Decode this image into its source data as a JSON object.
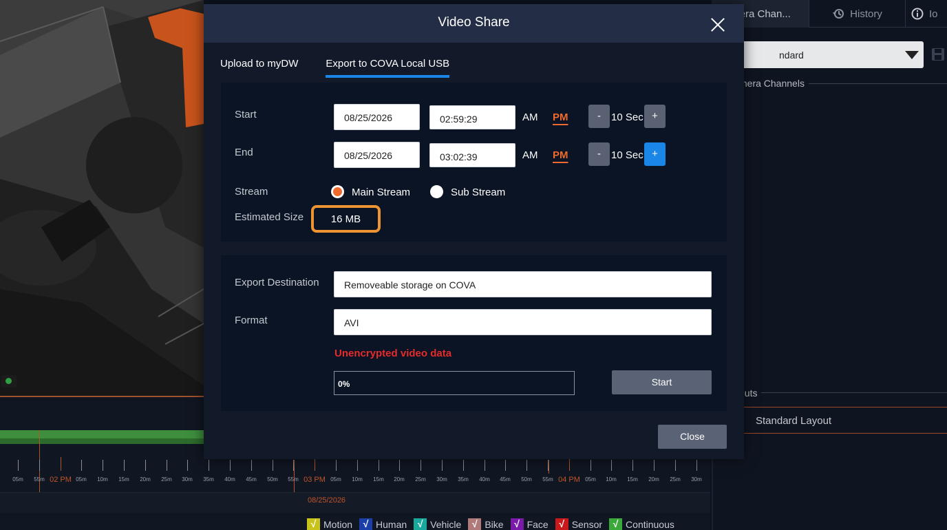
{
  "modal": {
    "title": "Video Share",
    "tabs": [
      {
        "label": "Upload to myDW",
        "active": false
      },
      {
        "label": "Export to COVA Local USB",
        "active": true
      }
    ],
    "start": {
      "label": "Start",
      "date": "08/25/2026",
      "time": "02:59:29",
      "am": "AM",
      "pm": "PM",
      "selected_period": "PM",
      "minus": "-",
      "step": "10 Sec",
      "plus": "+"
    },
    "end": {
      "label": "End",
      "date": "08/25/2026",
      "time": "03:02:39",
      "am": "AM",
      "pm": "PM",
      "selected_period": "PM",
      "minus": "-",
      "step": "10 Sec",
      "plus": "+"
    },
    "stream": {
      "label": "Stream",
      "options": [
        "Main Stream",
        "Sub Stream"
      ],
      "selected": "Main Stream"
    },
    "estimated_size": {
      "label": "Estimated Size",
      "value": "16 MB"
    },
    "export_destination": {
      "label": "Export Destination",
      "value": "Removeable storage on COVA"
    },
    "format": {
      "label": "Format",
      "value": "AVI"
    },
    "warning": "Unencrypted video data",
    "progress": {
      "text": "0%",
      "value": 0
    },
    "start_button": "Start",
    "close_button": "Close"
  },
  "right_panel": {
    "tabs": [
      "mera Chan...",
      "History",
      "Io"
    ],
    "layout_select": "ndard",
    "camera_channels_heading": "mera Channels",
    "layouts_heading": "outs",
    "layout_item": "Standard Layout"
  },
  "timeline": {
    "date": "08/25/2026",
    "hour_labels": [
      "02 PM",
      "03 PM",
      "04 PM"
    ],
    "minute_labels_head": [
      "55m"
    ],
    "minute_labels": [
      "05m",
      "10m",
      "15m",
      "20m",
      "25m",
      "30m",
      "35m",
      "40m",
      "45m",
      "50m",
      "55m"
    ],
    "legend": [
      "Motion",
      "Human",
      "Vehicle",
      "Bike",
      "Face",
      "Sensor",
      "Continuous"
    ]
  },
  "colors": {
    "accent_orange": "#ee6b2d",
    "highlight_box": "#ee9433",
    "tab_underline": "#1a86e8",
    "warning_red": "#e52b2b",
    "legend": [
      "#c8c21a",
      "#1a3fa8",
      "#1aa89c",
      "#b07a7a",
      "#7a1aa8",
      "#c81a1a",
      "#3aa83a"
    ]
  }
}
